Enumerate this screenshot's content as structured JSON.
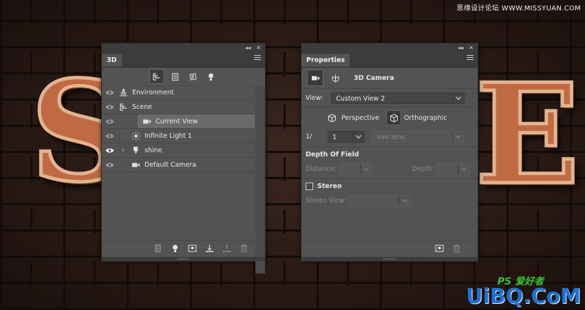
{
  "background": {
    "letters": [
      "S",
      "E"
    ],
    "watermark_top": "思缘设计论坛 WWW.MISSYUAN.COM",
    "watermark_ps": "PS 爱好者",
    "watermark_site": "UiBQ.CoM"
  },
  "panel3d": {
    "tab": "3D",
    "collapse_glyph": "◂◂",
    "close_glyph": "✕",
    "toolbar": [
      "scene-filter-icon",
      "mesh-filter-icon",
      "material-filter-icon",
      "light-filter-icon"
    ],
    "layers": [
      {
        "label": "Environment",
        "icon": "environment-icon",
        "eye": true,
        "expander": false,
        "indent": false,
        "selected": false
      },
      {
        "label": "Scene",
        "icon": "scene-icon",
        "eye": true,
        "expander": false,
        "indent": false,
        "selected": false
      },
      {
        "label": "Current View",
        "icon": "camera-icon",
        "eye": true,
        "expander": false,
        "indent": true,
        "selected": true
      },
      {
        "label": "Infinite Light 1",
        "icon": "sun-icon",
        "eye": true,
        "expander": false,
        "indent": true,
        "selected": false
      },
      {
        "label": "shine",
        "icon": "mesh-icon",
        "eye": true,
        "expander": true,
        "indent": true,
        "selected": false
      },
      {
        "label": "Default Camera",
        "icon": "camera-icon",
        "eye": true,
        "expander": false,
        "indent": true,
        "selected": false
      }
    ],
    "expander_glyph": "›",
    "bottom_icons": [
      "new-mesh-icon",
      "add-light-icon",
      "render-icon",
      "drop-to-plane-icon",
      "constraint-icon",
      "trash-icon"
    ]
  },
  "properties": {
    "tab": "Properties",
    "collapse_glyph": "◂◂",
    "close_glyph": "✕",
    "header_title": "3D Camera",
    "view_label": "View:",
    "view_value": "Custom View 2",
    "perspective_label": "Perspective",
    "orthographic_label": "Orthographic",
    "zoom_prefix": "1/",
    "zoom_value": "1",
    "lens_placeholder": "mm lens",
    "dof_title": "Depth Of Field",
    "distance_label": "Distance:",
    "depth_label": "Depth:",
    "stereo_label": "Stereo",
    "stereo_view_label": "Stereo View:",
    "bottom_icons": [
      "render-icon",
      "trash-icon"
    ]
  }
}
